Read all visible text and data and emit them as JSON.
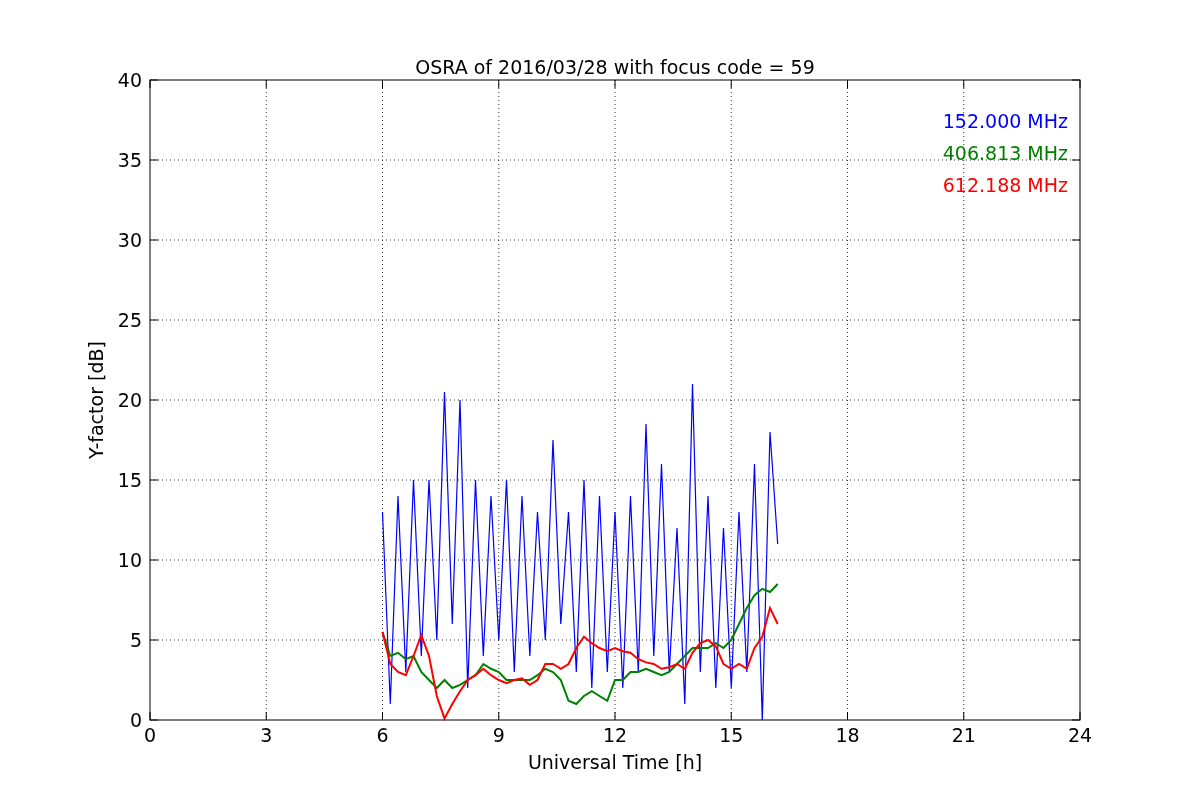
{
  "chart_data": {
    "type": "line",
    "title": "OSRA of 2016/03/28 with focus code = 59",
    "xlabel": "Universal Time [h]",
    "ylabel": "Y-factor [dB]",
    "x": [
      6.0,
      6.2,
      6.4,
      6.6,
      6.8,
      7.0,
      7.2,
      7.4,
      7.6,
      7.8,
      8.0,
      8.2,
      8.4,
      8.6,
      8.8,
      9.0,
      9.2,
      9.4,
      9.6,
      9.8,
      10.0,
      10.2,
      10.4,
      10.6,
      10.8,
      11.0,
      11.2,
      11.4,
      11.6,
      11.8,
      12.0,
      12.2,
      12.4,
      12.6,
      12.8,
      13.0,
      13.2,
      13.4,
      13.6,
      13.8,
      14.0,
      14.2,
      14.4,
      14.6,
      14.8,
      15.0,
      15.2,
      15.4,
      15.6,
      15.8,
      16.0,
      16.2
    ],
    "series": [
      {
        "name": "152.000 MHz",
        "color": "#0000ff",
        "values": [
          13,
          1,
          14,
          3,
          15,
          4,
          15,
          5,
          20.5,
          6,
          20,
          2,
          15,
          4,
          14,
          5,
          15,
          3,
          14,
          4,
          13,
          5,
          17.5,
          6,
          13,
          3,
          15,
          2,
          14,
          3,
          13,
          2,
          14,
          3,
          18.5,
          4,
          16,
          3,
          12,
          1,
          21,
          3,
          14,
          2,
          12,
          2,
          13,
          3,
          16,
          0,
          18,
          11
        ]
      },
      {
        "name": "406.813 MHz",
        "color": "#008000",
        "values": [
          5.5,
          4,
          4.2,
          3.8,
          4,
          3,
          2.5,
          2,
          2.5,
          2,
          2.2,
          2.5,
          2.8,
          3.5,
          3.2,
          3,
          2.5,
          2.5,
          2.5,
          2.5,
          2.8,
          3.2,
          3,
          2.5,
          1.2,
          1,
          1.5,
          1.8,
          1.5,
          1.2,
          2.5,
          2.5,
          3,
          3,
          3.2,
          3,
          2.8,
          3,
          3.5,
          4,
          4.5,
          4.5,
          4.5,
          4.8,
          4.5,
          5,
          6,
          7,
          7.8,
          8.2,
          8,
          8.5
        ]
      },
      {
        "name": "612.188 MHz",
        "color": "#ff0000",
        "values": [
          5.5,
          3.5,
          3,
          2.8,
          4,
          5.3,
          4,
          1.5,
          0.1,
          1,
          1.8,
          2.5,
          2.8,
          3.2,
          2.8,
          2.5,
          2.3,
          2.5,
          2.6,
          2.2,
          2.5,
          3.5,
          3.5,
          3.2,
          3.5,
          4.5,
          5.2,
          4.8,
          4.5,
          4.3,
          4.5,
          4.3,
          4.2,
          3.8,
          3.6,
          3.5,
          3.2,
          3.3,
          3.5,
          3.2,
          4.2,
          4.8,
          5,
          4.6,
          3.5,
          3.2,
          3.5,
          3.2,
          4.5,
          5.2,
          7,
          6
        ]
      }
    ],
    "xlim": [
      0,
      24
    ],
    "ylim": [
      0,
      40
    ],
    "xticks": [
      0,
      3,
      6,
      9,
      12,
      15,
      18,
      21,
      24
    ],
    "yticks": [
      0,
      5,
      10,
      15,
      20,
      25,
      30,
      35,
      40
    ],
    "grid": true
  }
}
